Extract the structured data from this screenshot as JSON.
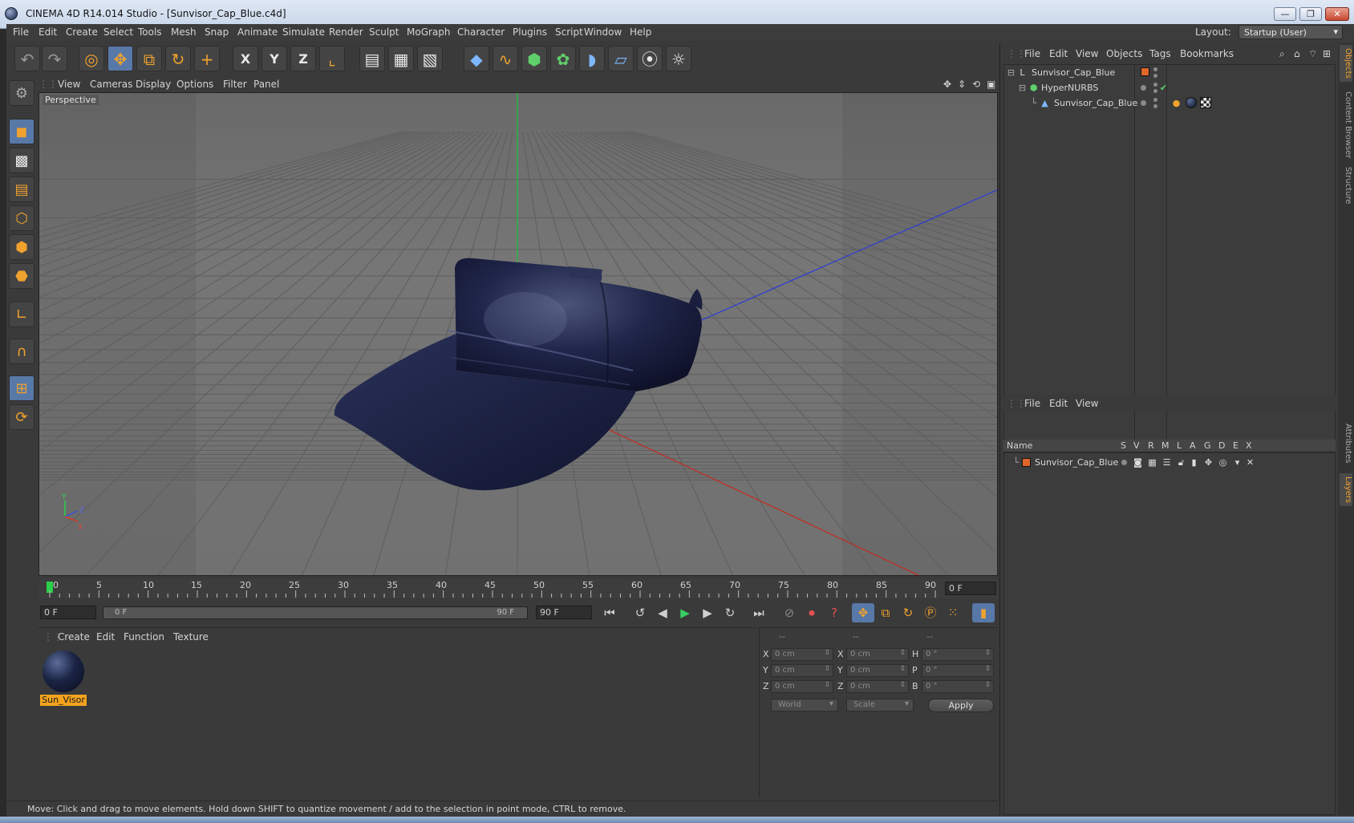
{
  "window": {
    "title": "CINEMA 4D R14.014 Studio - [Sunvisor_Cap_Blue.c4d]",
    "minimize": "—",
    "restore": "❐",
    "close": "✕"
  },
  "menubar": {
    "items": [
      "File",
      "Edit",
      "Create",
      "Select",
      "Tools",
      "Mesh",
      "Snap",
      "Animate",
      "Simulate",
      "Render",
      "Sculpt",
      "MoGraph",
      "Character",
      "Plugins",
      "Script",
      "Window",
      "Help"
    ],
    "layout_label": "Layout:",
    "layout_value": "Startup (User)"
  },
  "toolbar": {
    "icons": [
      "undo-icon",
      "redo-icon",
      "live-selection-icon",
      "move-icon",
      "scale-icon",
      "rotate-icon",
      "add-icon",
      "x-axis-icon",
      "y-axis-icon",
      "z-axis-icon",
      "coordinate-system-icon",
      "render-view-icon",
      "render-picture-viewer-icon",
      "edit-render-settings-icon",
      "cube-icon",
      "spline-icon",
      "nurbs-icon",
      "array-icon",
      "deformer-icon",
      "floor-icon",
      "camera-icon",
      "light-icon"
    ],
    "axis_labels": [
      "X",
      "Y",
      "Z"
    ]
  },
  "viewport": {
    "menu": [
      "View",
      "Cameras",
      "Display",
      "Options",
      "Filter",
      "Panel"
    ],
    "label": "Perspective",
    "model_color": "#1f2440",
    "axis_labels": [
      "Y",
      "Z",
      "X"
    ]
  },
  "timeline": {
    "ticks": [
      "0",
      "5",
      "10",
      "15",
      "20",
      "25",
      "30",
      "35",
      "40",
      "45",
      "50",
      "55",
      "60",
      "65",
      "70",
      "75",
      "80",
      "85",
      "90"
    ],
    "current_frame": "0 F",
    "start_field": "0 F",
    "range_start": "0 F",
    "range_end": "90 F",
    "end_field": "90 F"
  },
  "materials": {
    "menu": [
      "Create",
      "Edit",
      "Function",
      "Texture"
    ],
    "items": [
      {
        "name": "Sun_Visor"
      }
    ]
  },
  "coordinates": {
    "headers": [
      "--",
      "--",
      "--"
    ],
    "rows": [
      {
        "pos_label": "X",
        "pos_value": "0 cm",
        "size_label": "X",
        "size_value": "0 cm",
        "rot_label": "H",
        "rot_value": "0 °"
      },
      {
        "pos_label": "Y",
        "pos_value": "0 cm",
        "size_label": "Y",
        "size_value": "0 cm",
        "rot_label": "P",
        "rot_value": "0 °"
      },
      {
        "pos_label": "Z",
        "pos_value": "0 cm",
        "size_label": "Z",
        "size_value": "0 cm",
        "rot_label": "B",
        "rot_value": "0 °"
      }
    ],
    "mode_select": "World",
    "scale_select": "Scale",
    "apply": "Apply"
  },
  "status": {
    "text": "Move: Click and drag to move elements. Hold down SHIFT to quantize movement / add to the selection in point mode, CTRL to remove."
  },
  "objects_panel": {
    "menu": [
      "File",
      "Edit",
      "View",
      "Objects",
      "Tags",
      "Bookmarks"
    ],
    "objects": [
      {
        "name": "Sunvisor_Cap_Blue",
        "type": "null"
      },
      {
        "name": "HyperNURBS",
        "type": "hypernurbs"
      },
      {
        "name": "Sunvisor_Cap_Blue",
        "type": "polygon"
      }
    ]
  },
  "layers_panel": {
    "menu": [
      "File",
      "Edit",
      "View"
    ],
    "columns": [
      "Name",
      "S",
      "V",
      "R",
      "M",
      "L",
      "A",
      "G",
      "D",
      "E",
      "X"
    ],
    "layers": [
      {
        "name": "Sunvisor_Cap_Blue",
        "color": "#e0662a"
      }
    ]
  },
  "side_tabs": [
    "Objects",
    "Content Browser",
    "Structure",
    "Attributes",
    "Layers"
  ],
  "colors": {
    "accent_orange": "#f0a22e",
    "selection_blue": "#5878a8",
    "layer_orange": "#e0662a"
  }
}
